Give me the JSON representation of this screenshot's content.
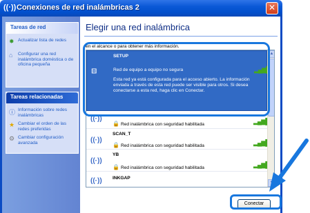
{
  "window": {
    "title": "Conexiones de red inalámbricas 2",
    "icon": "wireless-icon"
  },
  "sidebar": {
    "tasks_title": "Tareas de red",
    "tasks": [
      {
        "label": "Actualizar lista de redes",
        "icon": "refresh-icon"
      },
      {
        "label": "Configurar una red inalámbrica doméstica o de oficina pequeña",
        "icon": "setup-network-icon"
      }
    ],
    "related_title": "Tareas relacionadas",
    "related": [
      {
        "label": "Información sobre redes inalámbricas",
        "icon": "info-icon"
      },
      {
        "label": "Cambiar el orden de las redes preferidas",
        "icon": "star-icon"
      },
      {
        "label": "Cambiar configuración avanzada",
        "icon": "gear-icon"
      }
    ]
  },
  "main": {
    "heading": "Elegir una red inalámbrica",
    "hint": "en el alcance o para obtener más información.",
    "networks": [
      {
        "name": "SETUP",
        "security": "Red de equipo a equipo no segura",
        "description": "Esta red ya está configurada para el acceso abierto. La información enviada a través de esta red puede ser visible para otros. Si desea conectarse a esta red, haga clic en Conectar.",
        "selected": true
      },
      {
        "name": "",
        "security": "Red inalámbrica con seguridad habilitada",
        "selected": false
      },
      {
        "name": "SCAN_T",
        "security": "Red inalámbrica con seguridad habilitada",
        "selected": false
      },
      {
        "name": "YB",
        "security": "Red inalámbrica con seguridad habilitada",
        "selected": false
      },
      {
        "name": "INKGAP",
        "security": "",
        "selected": false
      }
    ],
    "connect_label": "Conectar"
  },
  "colors": {
    "accent": "#316ac5",
    "annotation": "#1877de",
    "titlebar": "#0a58d6"
  }
}
